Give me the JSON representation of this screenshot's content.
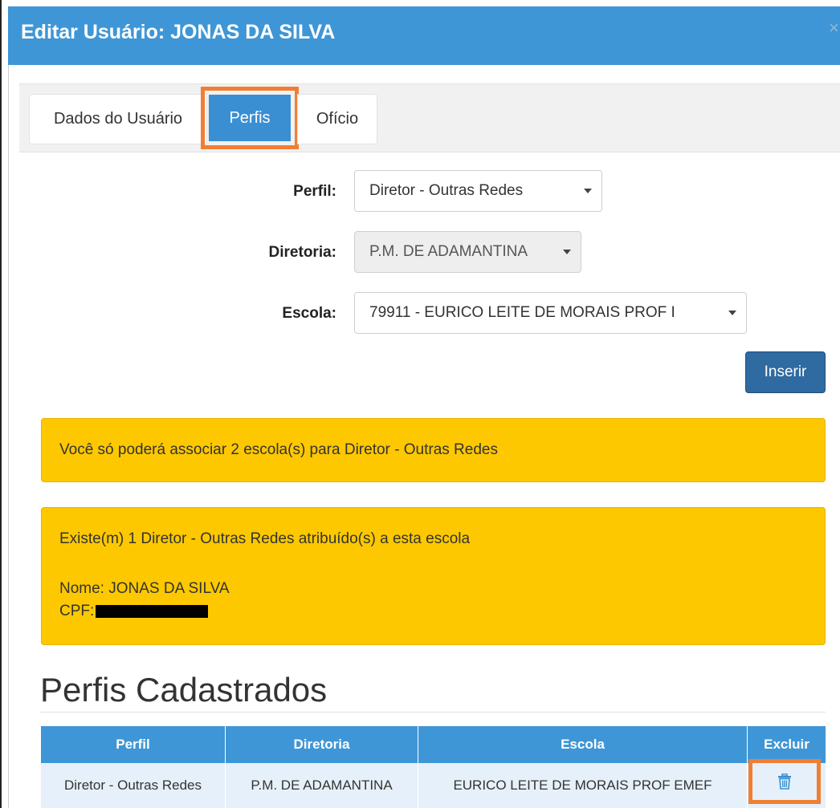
{
  "modal": {
    "title": "Editar Usuário: JONAS DA SILVA",
    "close_symbol": "×"
  },
  "tabs": [
    {
      "label": "Dados do Usuário",
      "active": false
    },
    {
      "label": "Perfis",
      "active": true
    },
    {
      "label": "Ofício",
      "active": false
    }
  ],
  "form": {
    "perfil_label": "Perfil:",
    "perfil_value": "Diretor - Outras Redes",
    "diretoria_label": "Diretoria:",
    "diretoria_value": "P.M. DE ADAMANTINA",
    "escola_label": "Escola:",
    "escola_value": "79911 - EURICO LEITE DE MORAIS PROF I",
    "insert_button": "Inserir"
  },
  "alerts": {
    "limit_message": "Você só poderá associar 2 escola(s) para Diretor - Outras Redes",
    "existing_message": "Existe(m) 1 Diretor - Outras Redes atribuído(s) a esta escola",
    "name_line": "Nome: JONAS DA SILVA",
    "cpf_label": "CPF:"
  },
  "profiles_section": {
    "title": "Perfis Cadastrados",
    "columns": [
      "Perfil",
      "Diretoria",
      "Escola",
      "Excluir"
    ],
    "rows": [
      {
        "perfil": "Diretor - Outras Redes",
        "diretoria": "P.M. DE ADAMANTINA",
        "escola": "EURICO LEITE DE MORAIS PROF EMEF",
        "action_icon": "trash-icon"
      }
    ]
  },
  "colors": {
    "header_blue": "#3f96d6",
    "active_tab": "#3a8fd3",
    "button_dark_blue": "#2f6aa0",
    "alert_yellow": "#fdc800",
    "highlight_orange": "#f07f33",
    "row_bg": "#e6f0fa"
  }
}
